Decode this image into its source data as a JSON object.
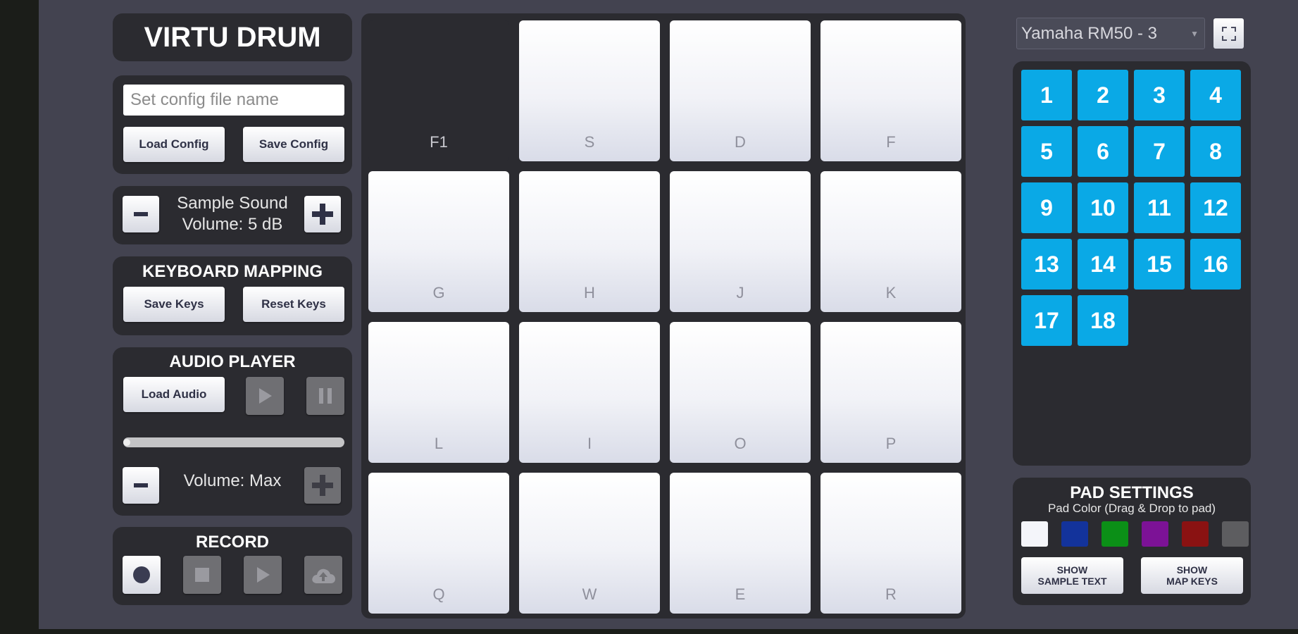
{
  "app": {
    "title": "VIRTU DRUM"
  },
  "config": {
    "input_placeholder": "Set config file name",
    "input_value": "",
    "load_label": "Load Config",
    "save_label": "Save Config"
  },
  "sample_volume": {
    "line1": "Sample Sound",
    "line2": "Volume: 5 dB",
    "minus_icon": "minus-icon",
    "plus_icon": "plus-icon"
  },
  "keyboard_mapping": {
    "heading": "KEYBOARD MAPPING",
    "save_label": "Save Keys",
    "reset_label": "Reset Keys"
  },
  "audio_player": {
    "heading": "AUDIO PLAYER",
    "load_label": "Load Audio",
    "play_icon": "play-icon",
    "pause_icon": "pause-icon",
    "progress": 0,
    "volume_label": "Volume: Max"
  },
  "record": {
    "heading": "RECORD",
    "icons": [
      "record-icon",
      "stop-icon",
      "play-icon",
      "cloud-upload-icon"
    ]
  },
  "pads": [
    {
      "key": "F1",
      "empty": true
    },
    {
      "key": "S"
    },
    {
      "key": "D"
    },
    {
      "key": "F"
    },
    {
      "key": "G"
    },
    {
      "key": "H"
    },
    {
      "key": "J"
    },
    {
      "key": "K"
    },
    {
      "key": "L"
    },
    {
      "key": "I"
    },
    {
      "key": "O"
    },
    {
      "key": "P"
    },
    {
      "key": "Q"
    },
    {
      "key": "W"
    },
    {
      "key": "E"
    },
    {
      "key": "R"
    }
  ],
  "kit": {
    "selected": "Yamaha RM50 - 3",
    "fullscreen_icon": "fullscreen-icon"
  },
  "samples": [
    "1",
    "2",
    "3",
    "4",
    "5",
    "6",
    "7",
    "8",
    "9",
    "10",
    "11",
    "12",
    "13",
    "14",
    "15",
    "16",
    "17",
    "18"
  ],
  "pad_settings": {
    "heading": "PAD SETTINGS",
    "subheading": "Pad Color (Drag & Drop to pad)",
    "colors": [
      "#f4f5fa",
      "#13339b",
      "#0b8f17",
      "#7c1296",
      "#8a1212",
      "#5d5d60"
    ],
    "show_sample_text_label": "SHOW\nSAMPLE TEXT",
    "show_map_keys_label": "SHOW\nMAP KEYS"
  },
  "colors": {
    "accent": "#0aa9e6",
    "background": "#434350",
    "panel": "#2b2b30"
  }
}
